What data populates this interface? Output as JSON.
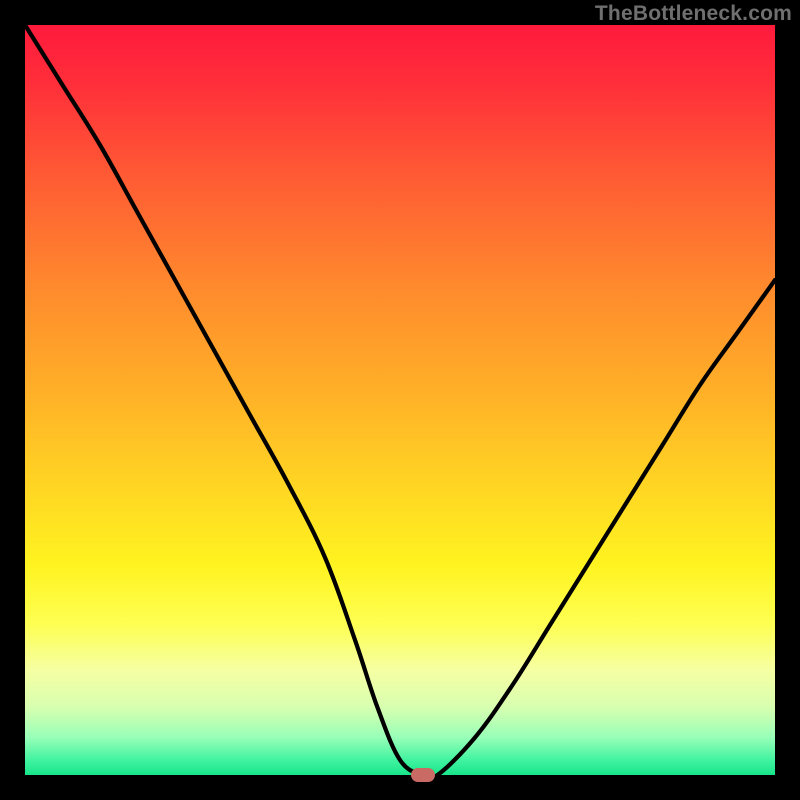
{
  "watermark": "TheBottleneck.com",
  "chart_data": {
    "type": "line",
    "title": "",
    "xlabel": "",
    "ylabel": "",
    "xlim": [
      0,
      100
    ],
    "ylim": [
      0,
      100
    ],
    "grid": false,
    "series": [
      {
        "name": "bottleneck-curve",
        "x": [
          0,
          5,
          10,
          15,
          20,
          25,
          30,
          35,
          40,
          44,
          47,
          50,
          53,
          55,
          60,
          65,
          70,
          75,
          80,
          85,
          90,
          95,
          100
        ],
        "values": [
          100,
          92,
          84,
          75,
          66,
          57,
          48,
          39,
          29,
          18,
          9,
          2,
          0,
          0,
          5,
          12,
          20,
          28,
          36,
          44,
          52,
          59,
          66
        ]
      }
    ],
    "marker": {
      "x": 53,
      "y": 0,
      "color": "#c96a64"
    },
    "gradient_stops": [
      {
        "pos": 0,
        "color": "#ff1a3c"
      },
      {
        "pos": 50,
        "color": "#ffb327"
      },
      {
        "pos": 80,
        "color": "#fdff53"
      },
      {
        "pos": 100,
        "color": "#18e58a"
      }
    ]
  }
}
